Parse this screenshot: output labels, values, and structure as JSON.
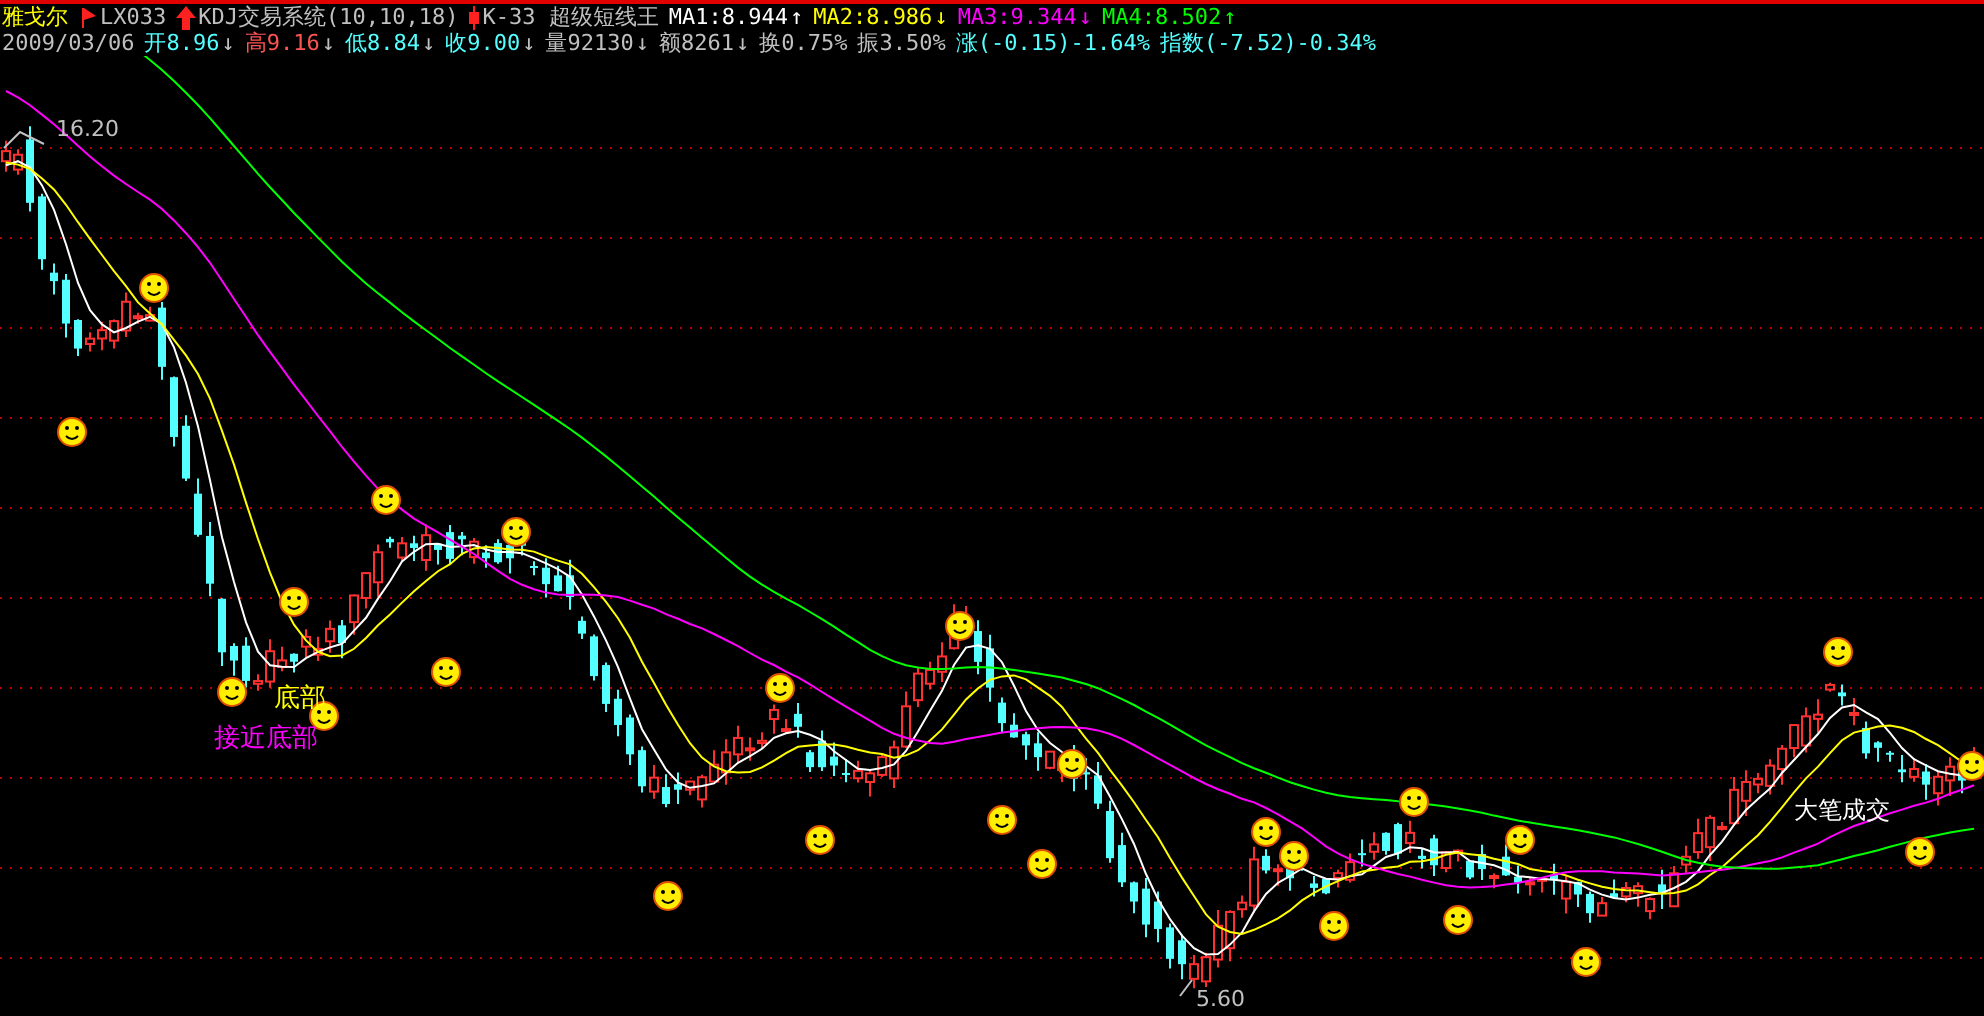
{
  "stock_name": "雅戈尔",
  "indicators": [
    {
      "kind": "flag",
      "label": "LX033"
    },
    {
      "kind": "arrow",
      "label": "KDJ交易系统(10,10,18)"
    },
    {
      "kind": "candle",
      "label": "K-33 超级短线王"
    }
  ],
  "moving_averages": [
    {
      "label": "MA1:8.944",
      "color": "#ffffff",
      "arrow": "↑"
    },
    {
      "label": "MA2:8.986",
      "color": "#ffff00",
      "arrow": "↓"
    },
    {
      "label": "MA3:9.344",
      "color": "#ff00ff",
      "arrow": "↓"
    },
    {
      "label": "MA4:8.502",
      "color": "#00ff00",
      "arrow": "↑"
    }
  ],
  "date": "2009/03/06",
  "quote_fields": [
    {
      "label": "开",
      "value": "8.96",
      "color": "#54ffff",
      "arrow": "↓"
    },
    {
      "label": "高",
      "value": "9.16",
      "color": "#ff5454",
      "arrow": "↓"
    },
    {
      "label": "低",
      "value": "8.84",
      "color": "#54ffff",
      "arrow": "↓"
    },
    {
      "label": "收",
      "value": "9.00",
      "color": "#54ffff",
      "arrow": "↓"
    },
    {
      "label": "量",
      "value": "92130",
      "color": "#c0c0c0",
      "arrow": "↓"
    },
    {
      "label": "额",
      "value": "8261",
      "color": "#c0c0c0",
      "arrow": "↓"
    },
    {
      "label": "换",
      "value": "0.75%",
      "color": "#c0c0c0"
    },
    {
      "label": "振",
      "value": "3.50%",
      "color": "#c0c0c0"
    },
    {
      "label": "涨",
      "value": "(-0.15)-1.64%",
      "color": "#54ffff"
    },
    {
      "label": "指数",
      "value": "(-7.52)-0.34%",
      "color": "#54ffff"
    }
  ],
  "price_labels": [
    {
      "kind": "high",
      "text": "16.20"
    },
    {
      "kind": "low",
      "text": "5.60"
    }
  ],
  "annotations": [
    {
      "kind": "bottom",
      "text": "底部",
      "color": "#ffff00"
    },
    {
      "kind": "near_bottom",
      "text": "接近底部",
      "color": "#ff00ff"
    },
    {
      "kind": "big_trade",
      "text": "大笔成交",
      "color": "#ffffff"
    }
  ]
}
